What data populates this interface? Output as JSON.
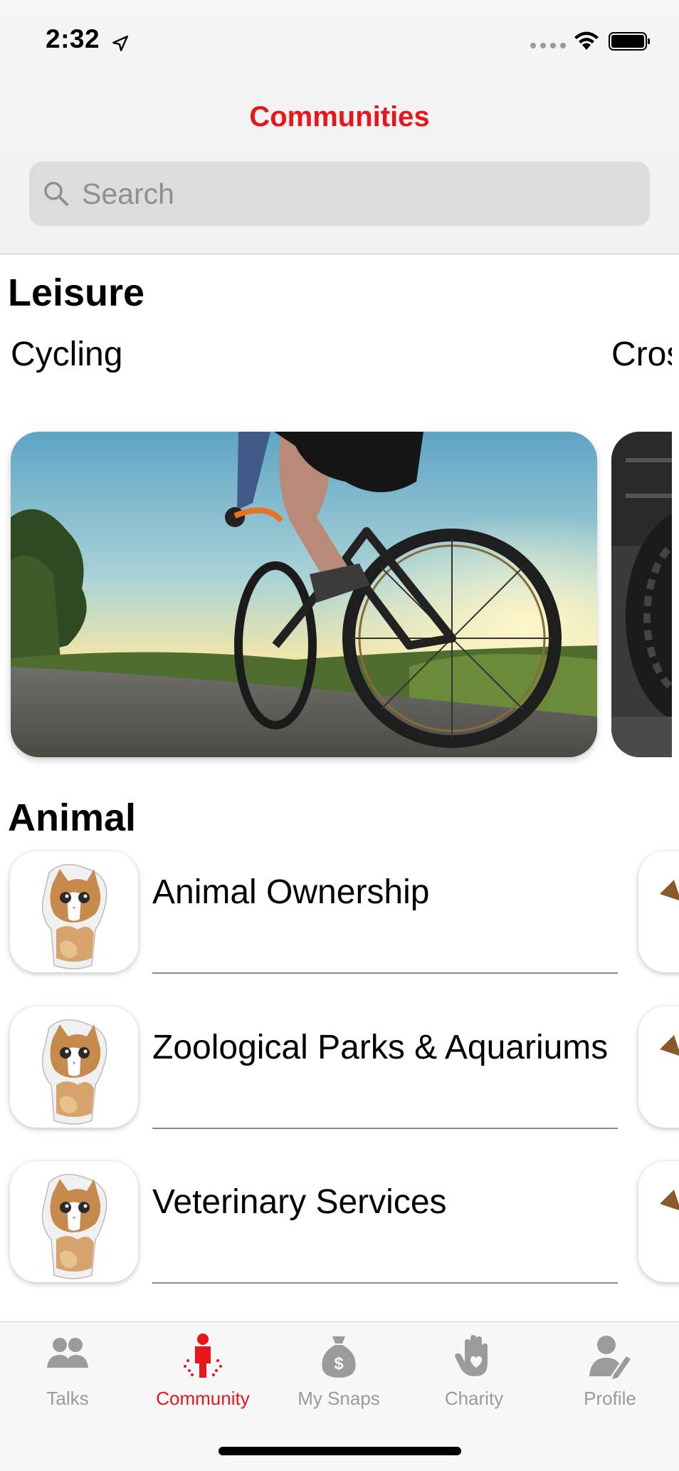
{
  "status_bar": {
    "time": "2:32"
  },
  "nav": {
    "title": "Communities",
    "title_color": "#e8161b"
  },
  "search": {
    "placeholder": "Search"
  },
  "sections": {
    "leisure": {
      "title": "Leisure",
      "items": [
        {
          "label": "Cycling",
          "image": "cycling-photo"
        },
        {
          "label": "Cros",
          "image": "crossfit-photo"
        }
      ]
    },
    "animal": {
      "title": "Animal",
      "items": [
        {
          "label": "Animal Ownership",
          "image": "cat-icon"
        },
        {
          "label": "Zoological Parks & Aquariums",
          "image": "cat-icon"
        },
        {
          "label": "Veterinary Services",
          "image": "cat-icon"
        }
      ]
    }
  },
  "tabbar": {
    "tabs": [
      {
        "label": "Talks",
        "icon": "people-icon",
        "active": false
      },
      {
        "label": "Community",
        "icon": "community-icon",
        "active": true
      },
      {
        "label": "My Snaps",
        "icon": "money-bag-icon",
        "active": false
      },
      {
        "label": "Charity",
        "icon": "hand-heart-icon",
        "active": false
      },
      {
        "label": "Profile",
        "icon": "profile-edit-icon",
        "active": false
      }
    ],
    "active_color": "#e8161b",
    "inactive_color": "#9b9b9b"
  }
}
